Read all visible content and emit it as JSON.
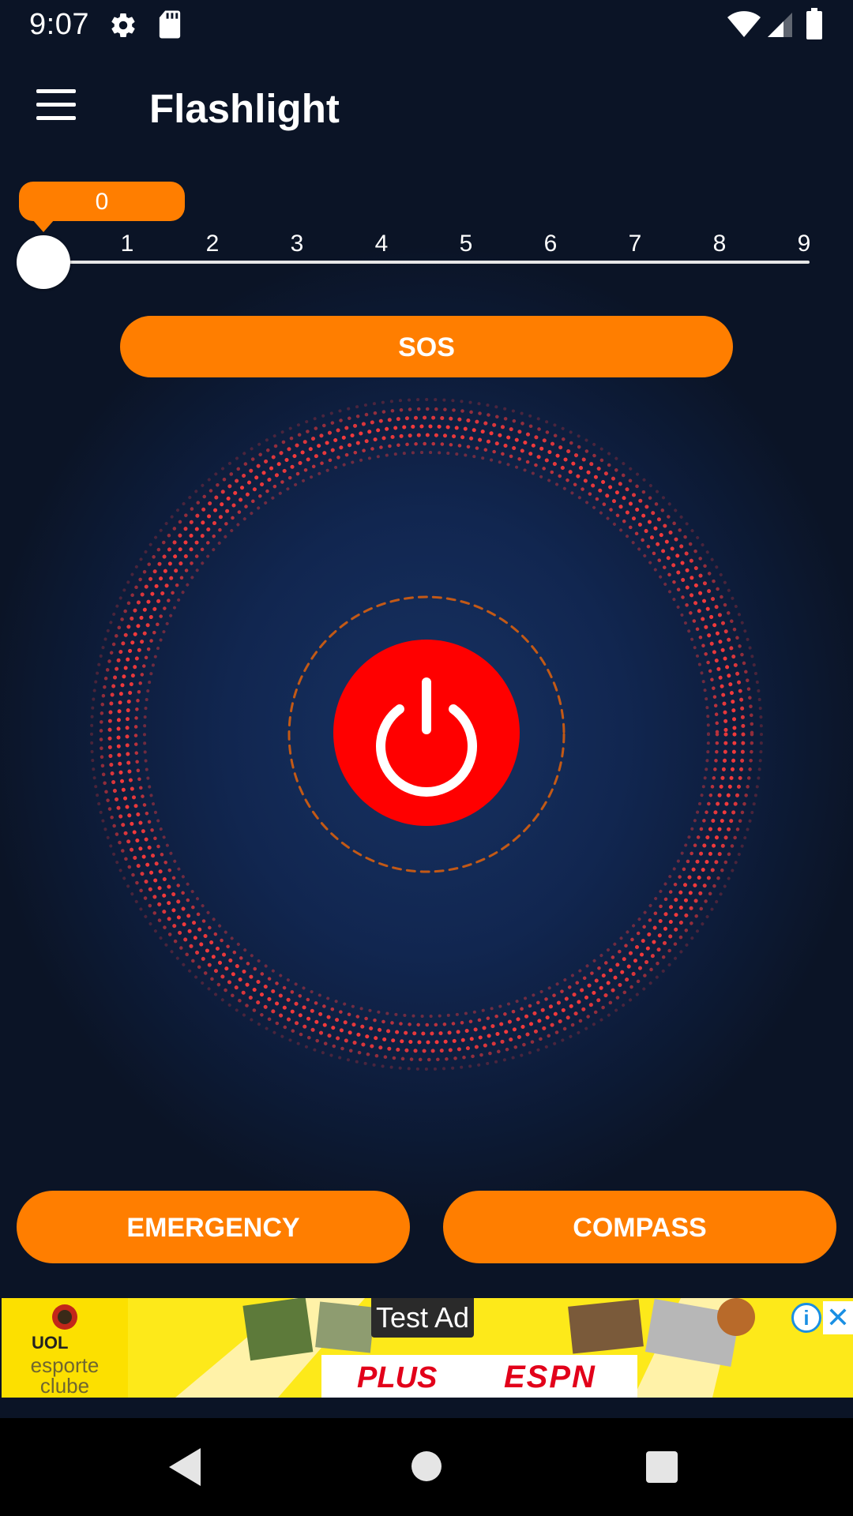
{
  "status_bar": {
    "time": "9:07",
    "icons": [
      "gear-icon",
      "sd-card-icon",
      "wifi-icon",
      "signal-icon",
      "battery-icon"
    ]
  },
  "app_bar": {
    "title": "Flashlight",
    "menu_icon": "menu-icon"
  },
  "slider": {
    "value": "0",
    "ticks": [
      "1",
      "2",
      "3",
      "4",
      "5",
      "6",
      "7",
      "8",
      "9"
    ],
    "level_fraction": 0.0
  },
  "buttons": {
    "sos": "SOS",
    "emergency": "EMERGENCY",
    "compass": "COMPASS",
    "power_icon": "power-icon"
  },
  "ad": {
    "label": "Test Ad",
    "brand_uol": "UOL",
    "brand_esporte": "esporte clube",
    "brand_plus": "PLUS",
    "brand_espn": "ESPN",
    "info_icon": "info-icon",
    "close_icon": "close-icon"
  },
  "nav_bar": {
    "back": "back-icon",
    "home": "home-icon",
    "recents": "recents-icon"
  },
  "colors": {
    "accent": "#ff7e00",
    "power": "#ff0000",
    "background": "#0b1426",
    "ring_dots": "#ff3b3b"
  }
}
